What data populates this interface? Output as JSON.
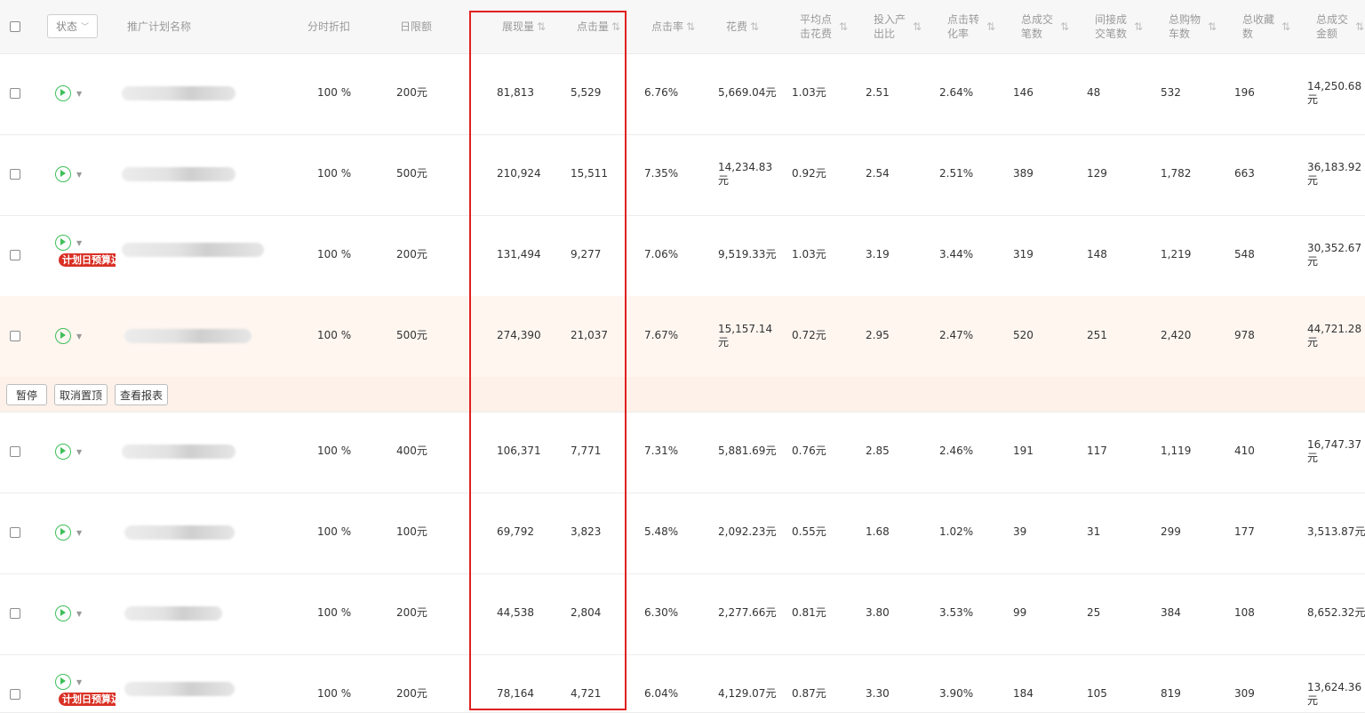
{
  "header": {
    "status_filter": "状态",
    "columns": {
      "name": "推广计划名称",
      "discount": "分时折扣",
      "budget": "日限额",
      "impressions": "展现量",
      "clicks": "点击量",
      "ctr": "点击率",
      "cost": "花费",
      "avg_cpc": [
        "平均点",
        "击花费"
      ],
      "roi": [
        "投入产",
        "出比"
      ],
      "cvr": [
        "点击转",
        "化率"
      ],
      "total_orders": [
        "总成交",
        "笔数"
      ],
      "indirect_orders": [
        "间接成",
        "交笔数"
      ],
      "carts": [
        "总购物",
        "车数"
      ],
      "favs": [
        "总收藏",
        "数"
      ],
      "total_amount": [
        "总成交",
        "金额"
      ]
    },
    "sort_icon": "⇅"
  },
  "rows": [
    {
      "discount": "100 %",
      "budget": "200元",
      "impressions": "81,813",
      "clicks": "5,529",
      "ctr": "6.76%",
      "cost": [
        "5,669.04元"
      ],
      "cpc": "1.03元",
      "roi": "2.51",
      "cvr": "2.64%",
      "orders": "146",
      "indirect": "48",
      "carts": "532",
      "favs": "196",
      "amount": [
        "14,250.68",
        "元"
      ],
      "badge": ""
    },
    {
      "discount": "100 %",
      "budget": "500元",
      "impressions": "210,924",
      "clicks": "15,511",
      "ctr": "7.35%",
      "cost": [
        "14,234.83",
        "元"
      ],
      "cpc": "0.92元",
      "roi": "2.54",
      "cvr": "2.51%",
      "orders": "389",
      "indirect": "129",
      "carts": "1,782",
      "favs": "663",
      "amount": [
        "36,183.92",
        "元"
      ],
      "badge": ""
    },
    {
      "discount": "100 %",
      "budget": "200元",
      "impressions": "131,494",
      "clicks": "9,277",
      "ctr": "7.06%",
      "cost": [
        "9,519.33元"
      ],
      "cpc": "1.03元",
      "roi": "3.19",
      "cvr": "3.44%",
      "orders": "319",
      "indirect": "148",
      "carts": "1,219",
      "favs": "548",
      "amount": [
        "30,352.67",
        "元"
      ],
      "badge": "计划日预算达"
    },
    {
      "discount": "100 %",
      "budget": "500元",
      "impressions": "274,390",
      "clicks": "21,037",
      "ctr": "7.67%",
      "cost": [
        "15,157.14",
        "元"
      ],
      "cpc": "0.72元",
      "roi": "2.95",
      "cvr": "2.47%",
      "orders": "520",
      "indirect": "251",
      "carts": "2,420",
      "favs": "978",
      "amount": [
        "44,721.28",
        "元"
      ],
      "badge": ""
    },
    {
      "discount": "100 %",
      "budget": "400元",
      "impressions": "106,371",
      "clicks": "7,771",
      "ctr": "7.31%",
      "cost": [
        "5,881.69元"
      ],
      "cpc": "0.76元",
      "roi": "2.85",
      "cvr": "2.46%",
      "orders": "191",
      "indirect": "117",
      "carts": "1,119",
      "favs": "410",
      "amount": [
        "16,747.37",
        "元"
      ],
      "badge": ""
    },
    {
      "discount": "100 %",
      "budget": "100元",
      "impressions": "69,792",
      "clicks": "3,823",
      "ctr": "5.48%",
      "cost": [
        "2,092.23元"
      ],
      "cpc": "0.55元",
      "roi": "1.68",
      "cvr": "1.02%",
      "orders": "39",
      "indirect": "31",
      "carts": "299",
      "favs": "177",
      "amount": [
        "3,513.87元"
      ],
      "badge": ""
    },
    {
      "discount": "100 %",
      "budget": "200元",
      "impressions": "44,538",
      "clicks": "2,804",
      "ctr": "6.30%",
      "cost": [
        "2,277.66元"
      ],
      "cpc": "0.81元",
      "roi": "3.80",
      "cvr": "3.53%",
      "orders": "99",
      "indirect": "25",
      "carts": "384",
      "favs": "108",
      "amount": [
        "8,652.32元"
      ],
      "badge": ""
    },
    {
      "discount": "100 %",
      "budget": "200元",
      "impressions": "78,164",
      "clicks": "4,721",
      "ctr": "6.04%",
      "cost": [
        "4,129.07元"
      ],
      "cpc": "0.87元",
      "roi": "3.30",
      "cvr": "3.90%",
      "orders": "184",
      "indirect": "105",
      "carts": "819",
      "favs": "309",
      "amount": [
        "13,624.36",
        "元"
      ],
      "badge": "计划日预算达"
    }
  ],
  "row_actions": {
    "pause": "暂停",
    "unpin": "取消置顶",
    "report": "查看报表"
  },
  "colors": {
    "highlight_box": "#e02020",
    "play_icon": "#3fbf5a",
    "badge": "#d93025",
    "row_highlight": "#fff6f0"
  }
}
